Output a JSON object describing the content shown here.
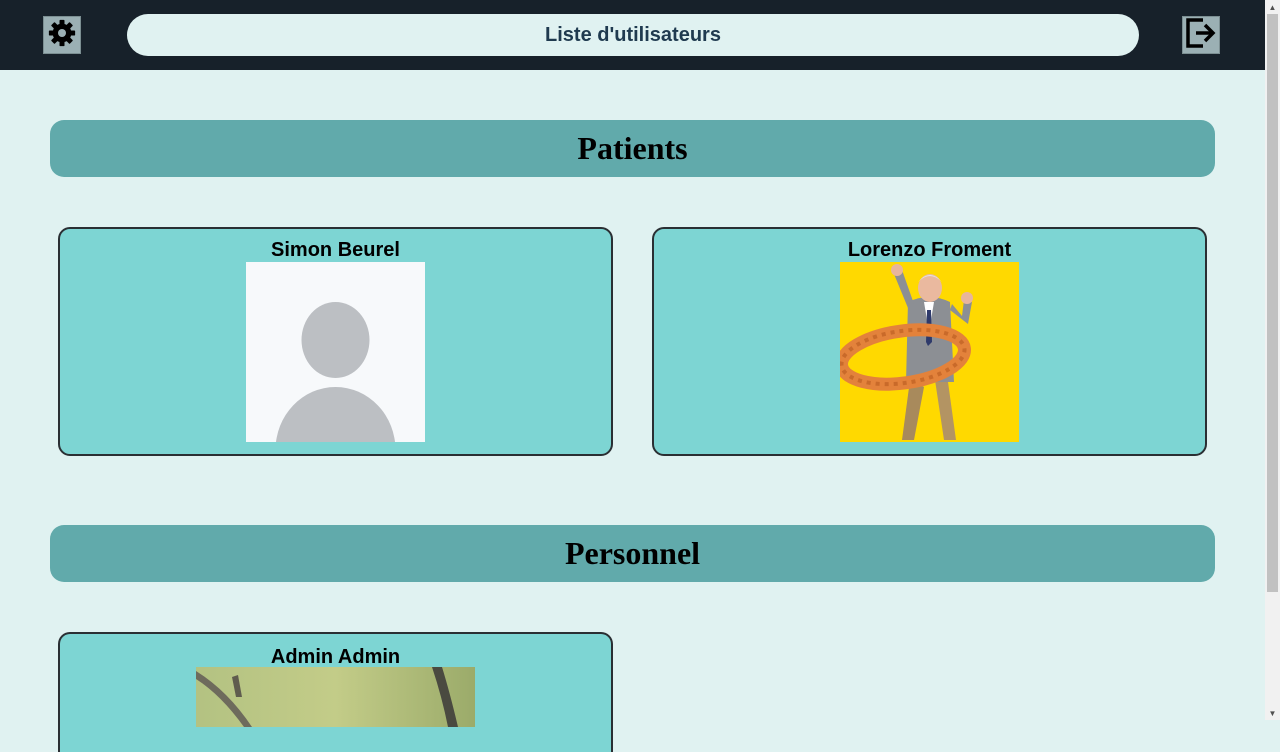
{
  "header": {
    "title": "Liste d'utilisateurs",
    "settings_icon": "gear-icon",
    "logout_icon": "logout-icon"
  },
  "sections": [
    {
      "title": "Patients",
      "users": [
        {
          "name": "Simon Beurel",
          "photo": "default-avatar-placeholder"
        },
        {
          "name": "Lorenzo Froment",
          "photo": "elderly-man-with-hula-hoop-photo"
        }
      ]
    },
    {
      "title": "Personnel",
      "users": [
        {
          "name": "Admin Admin",
          "photo": "bird-on-branch-photo"
        }
      ]
    }
  ],
  "colors": {
    "topbar": "#17212a",
    "page_background": "#e0f2f1",
    "section_header": "#61aaab",
    "card": "#7dd5d3",
    "title_text": "#1f3a4f"
  }
}
